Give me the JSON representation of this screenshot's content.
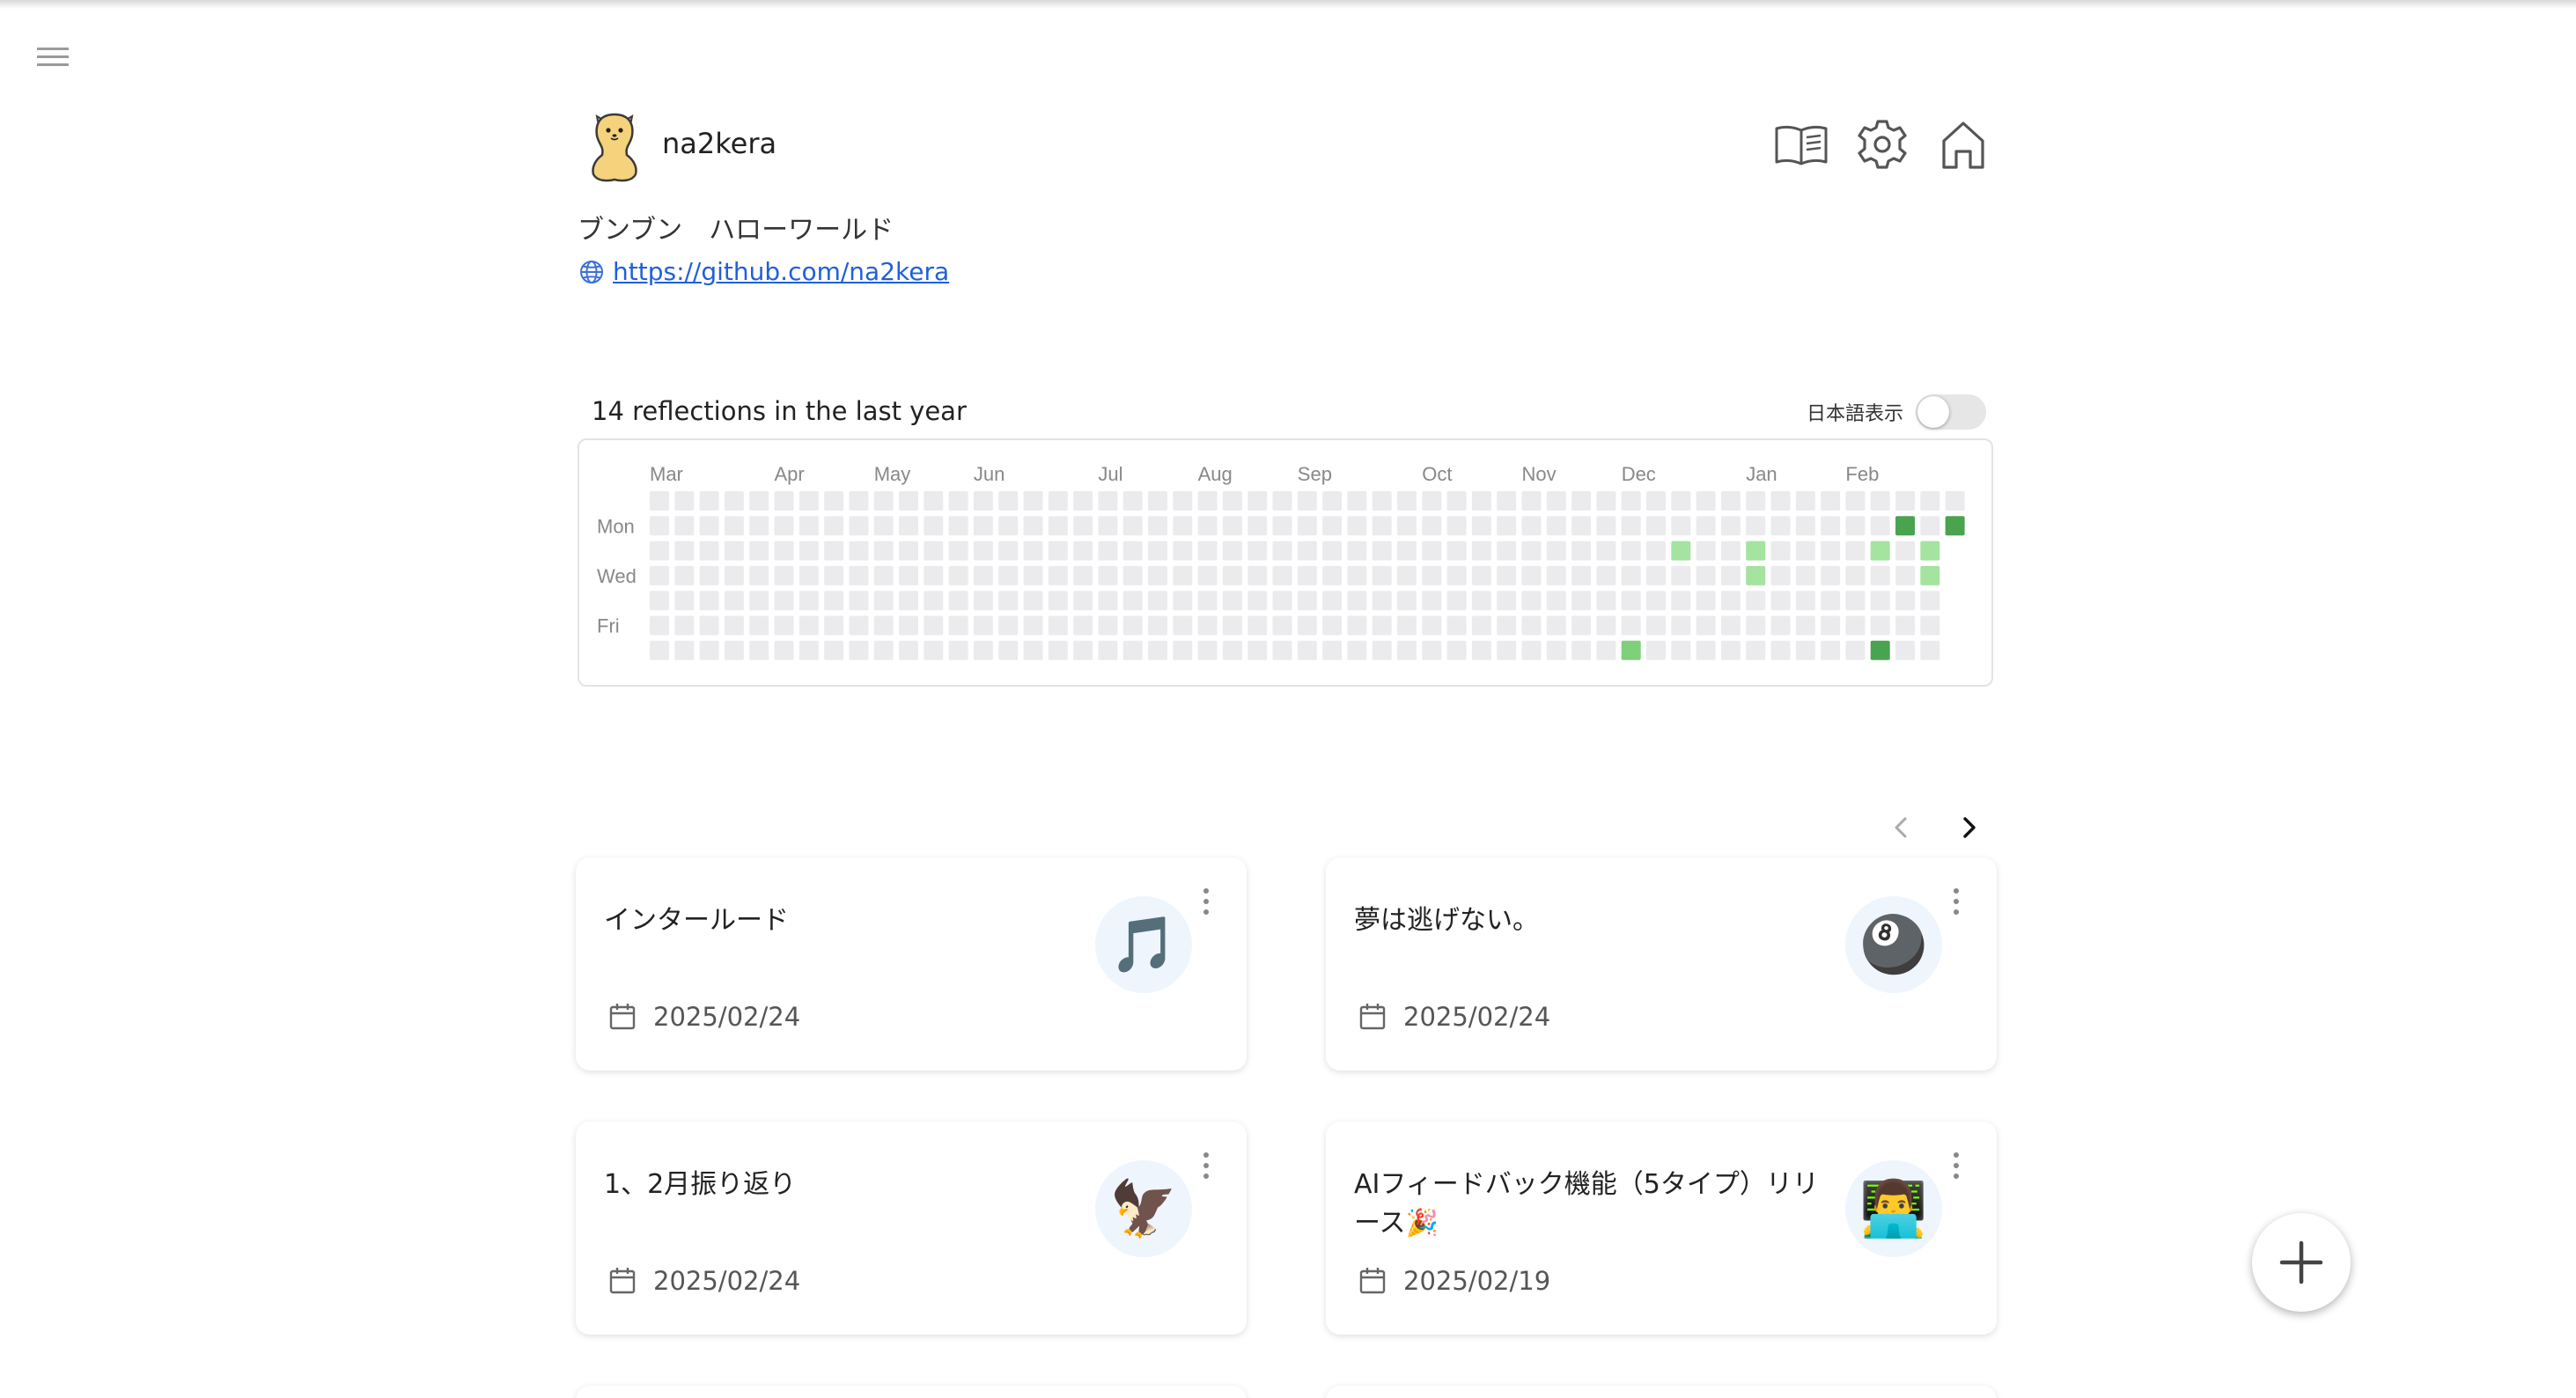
{
  "profile": {
    "username": "na2kera",
    "bio": "ブンブン　ハローワールド",
    "link": "https://github.com/na2kera"
  },
  "header_icons": [
    "book-icon",
    "gear-icon",
    "home-icon"
  ],
  "heatmap": {
    "title": "14 reflections in the last year",
    "toggle_label": "日本語表示",
    "toggle_on": false,
    "months": [
      "Mar",
      "Apr",
      "May",
      "Jun",
      "Jul",
      "Aug",
      "Sep",
      "Oct",
      "Nov",
      "Dec",
      "Jan",
      "Feb"
    ],
    "month_start_weeks": [
      0,
      5,
      9,
      13,
      18,
      22,
      26,
      31,
      35,
      39,
      44,
      48
    ],
    "weekdays": [
      "Mon",
      "Wed",
      "Fri"
    ],
    "weeks": 53,
    "last_week_days": 2,
    "active_cells": [
      {
        "week": 39,
        "day": 6,
        "level": 2
      },
      {
        "week": 41,
        "day": 2,
        "level": 1
      },
      {
        "week": 44,
        "day": 2,
        "level": 1
      },
      {
        "week": 44,
        "day": 3,
        "level": 1
      },
      {
        "week": 49,
        "day": 2,
        "level": 1
      },
      {
        "week": 49,
        "day": 6,
        "level": 3
      },
      {
        "week": 50,
        "day": 1,
        "level": 3
      },
      {
        "week": 51,
        "day": 2,
        "level": 1
      },
      {
        "week": 51,
        "day": 3,
        "level": 1
      },
      {
        "week": 52,
        "day": 1,
        "level": 3
      }
    ],
    "colors": {
      "empty": "#ebebee",
      "level1": "#a4e3a0",
      "level2": "#7fd07a",
      "level3": "#4aa34e"
    }
  },
  "pagination": {
    "prev": "‹",
    "next": "›"
  },
  "reflections": [
    {
      "title": "インタールード",
      "date": "2025/02/24",
      "emoji": "🎵"
    },
    {
      "title": "夢は逃げない。",
      "date": "2025/02/24",
      "emoji": "🎱"
    },
    {
      "title": "1、2月振り返り",
      "date": "2025/02/24",
      "emoji": "🦅"
    },
    {
      "title": "AIフィードバック機能（5タイプ）リリース🎉",
      "date": "2025/02/19",
      "emoji": "👨‍💻"
    }
  ],
  "fab_label": "+"
}
